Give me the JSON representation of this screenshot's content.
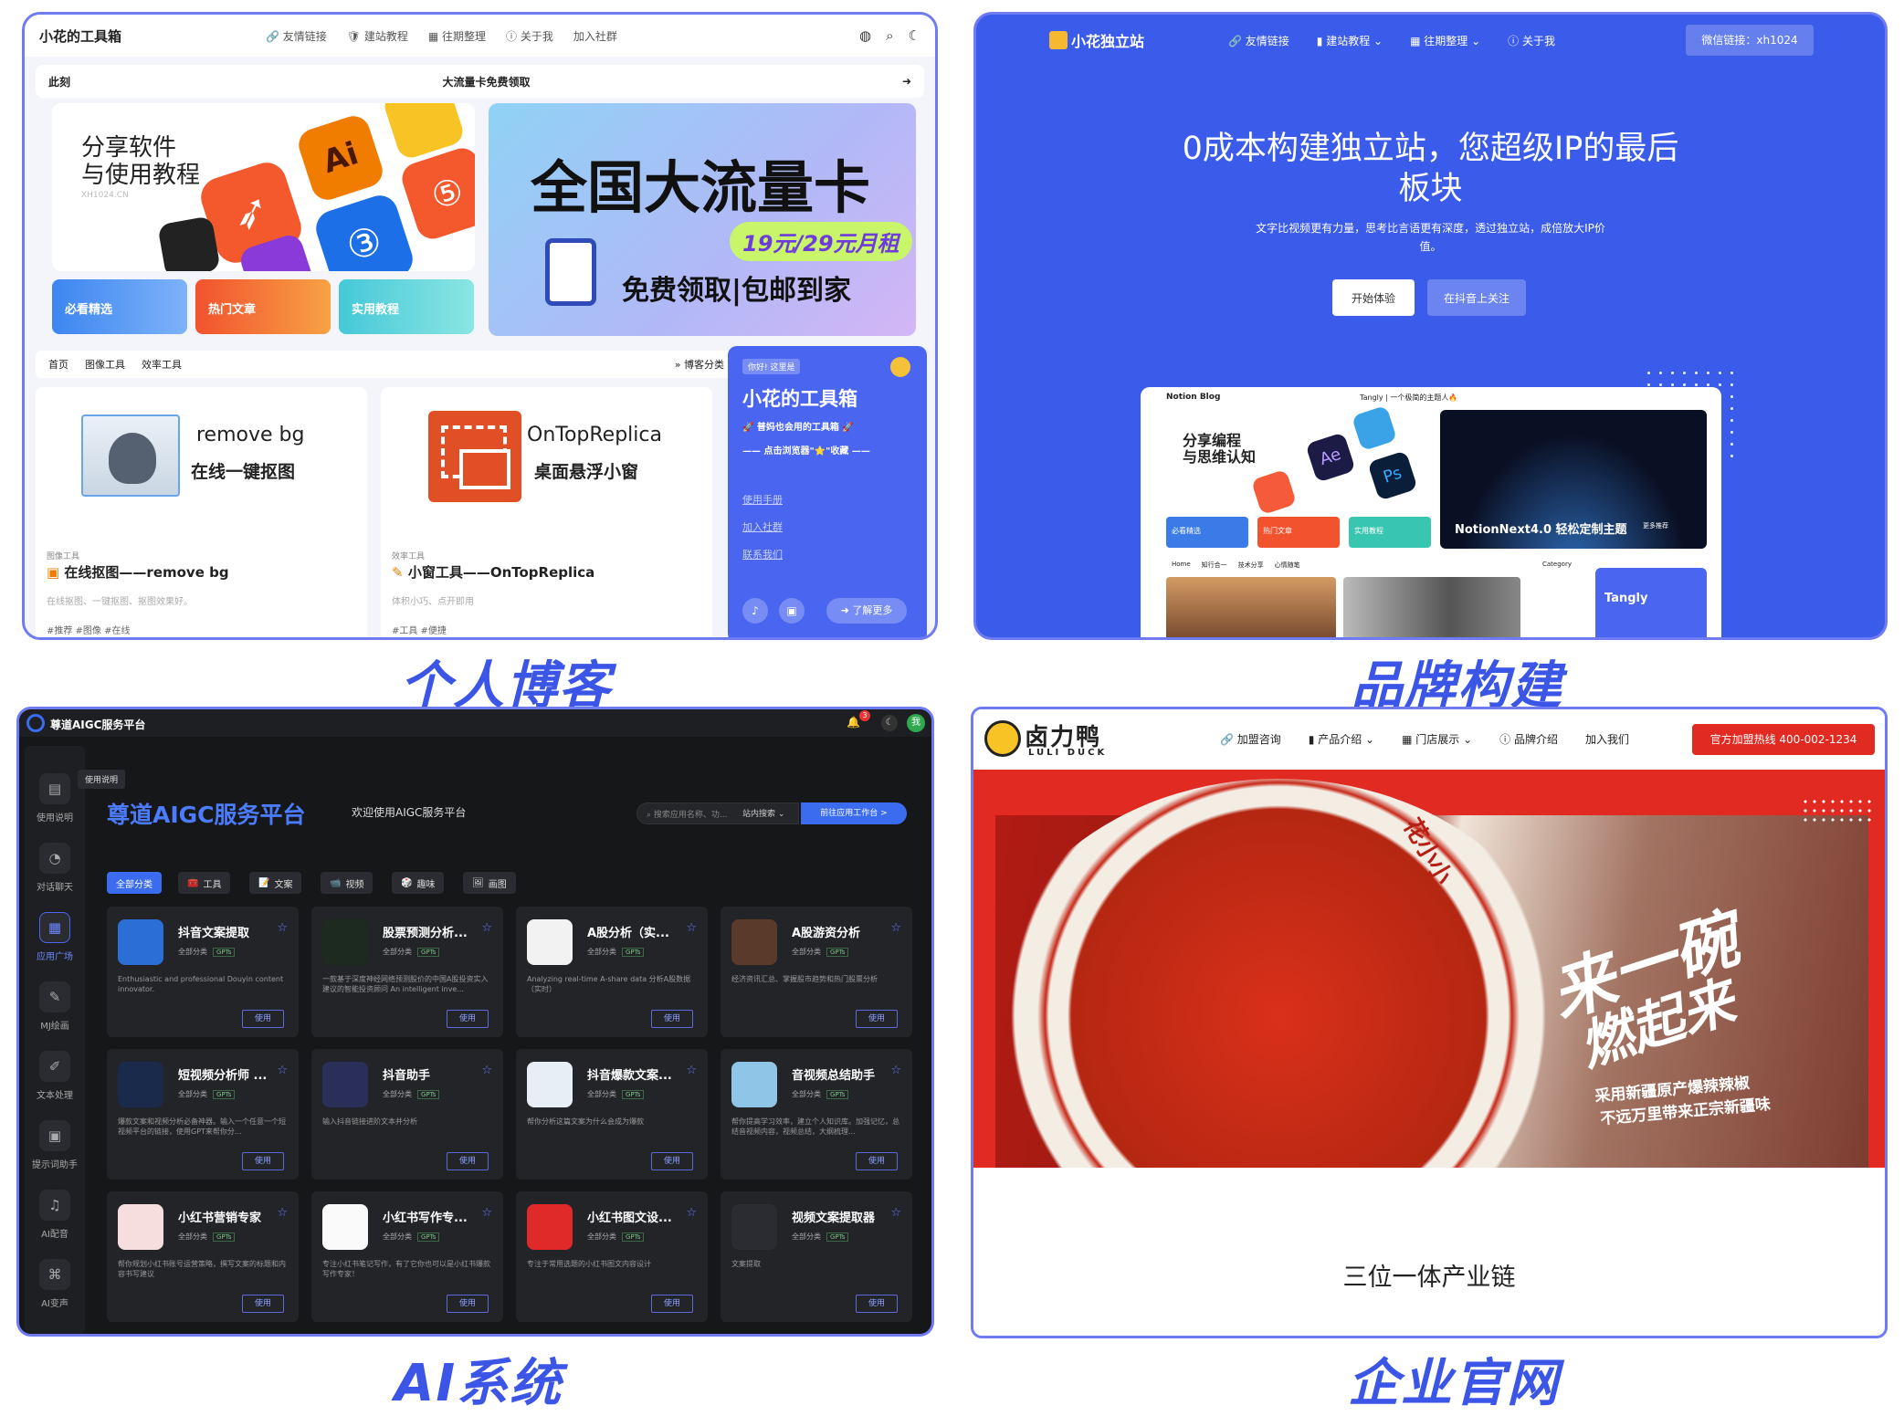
{
  "captions": {
    "blog": "个人博客",
    "brand": "品牌构建",
    "ai": "AI系统",
    "corp": "企业官网"
  },
  "blog": {
    "brand": "小花的工具箱",
    "nav": [
      "友情链接",
      "建站教程",
      "往期整理",
      "关于我",
      "加入社群"
    ],
    "notice_left": "此刻",
    "notice_center": "大流量卡免费领取",
    "banner_share_line1": "分享软件",
    "banner_share_line2": "与使用教程",
    "banner_share_sub": "XH1024.CN",
    "banner_card_title": "全国大流量卡",
    "banner_card_price": "19元/29元月租",
    "banner_card_sub": "免费领取|包邮到家",
    "quick": [
      "必看精选",
      "热门文章",
      "实用教程"
    ],
    "tabs": [
      "首页",
      "图像工具",
      "效率工具"
    ],
    "category_link": "博客分类",
    "cards": [
      {
        "img_title": "remove bg",
        "img_sub": "在线一键抠图",
        "tag": "图像工具",
        "title": "在线抠图——remove bg",
        "desc": "在线抠图、一键抠图、抠图效果好。",
        "tags": "#推荐   #图像   #在线"
      },
      {
        "img_title": "OnTopReplica",
        "img_sub": "桌面悬浮小窗",
        "tag": "效率工具",
        "title": "小窗工具——OnTopReplica",
        "desc": "体积小巧、点开即用",
        "tags": "#工具   #便捷"
      }
    ],
    "side": {
      "badge": "你好! 这里是",
      "title": "小花的工具箱",
      "sub1": "🚀 普妈也会用的工具箱 🚀",
      "sub2": "—— 点击浏览器\"⭐\"收藏 ——",
      "links": [
        "使用手册",
        "加入社群",
        "联系我们"
      ],
      "more": "了解更多"
    }
  },
  "brand": {
    "logo": "小花独立站",
    "nav": [
      "友情链接",
      "建站教程",
      "往期整理",
      "关于我"
    ],
    "wechat": "微信链接：xh1024",
    "headline1": "0成本构建独立站，您超级IP的最后",
    "headline2": "板块",
    "desc1": "文字比视频更有力量，思考比言语更有深度，透过独立站，成倍放大IP价",
    "desc2": "值。",
    "btn_primary": "开始体验",
    "btn_secondary": "在抖音上关注",
    "preview": {
      "title": "Notion Blog",
      "center": "Tangly | 一个极简的主题人🔥",
      "share1": "分享编程",
      "share2": "与思维认知",
      "quick": [
        "必看精选",
        "热门文章",
        "实用教程"
      ],
      "hero_text": "NotionNext4.0 轻松定制主题",
      "hero_btn": "更多推荐",
      "tabs": [
        "Home",
        "知行合一",
        "技术分享",
        "心情随笔"
      ],
      "category": "Category",
      "side_name": "Tangly"
    }
  },
  "ai": {
    "title": "尊道AIGC服务平台",
    "big_title": "尊道AIGC服务平台",
    "welcome": "欢迎使用AIGC服务平台",
    "notif_count": "3",
    "avatar": "我",
    "search_placeholder": "搜索应用名称、功...",
    "search_scope": "站内搜索",
    "go_btn": "前往应用工作台 >",
    "tooltip": "使用说明",
    "side": [
      "使用说明",
      "对话聊天",
      "应用广场",
      "MJ绘画",
      "文本处理",
      "提示词助手",
      "AI配音",
      "AI变声"
    ],
    "chips": [
      "全部分类",
      "工具",
      "文案",
      "视频",
      "趣味",
      "画图"
    ],
    "card_meta": "全部分类",
    "card_badge": "GPTs",
    "use": "使用",
    "cards": [
      {
        "t": "抖音文案提取",
        "d": "Enthusiastic and professional Douyin content innovator.",
        "c": "#2b6fd6"
      },
      {
        "t": "股票预测分析...",
        "d": "一款基于深度神经网络预测股价的中国A股投资实入建议的智能投资顾问 An intelligent inve...",
        "c": "#1d2a1f"
      },
      {
        "t": "A股分析（实...",
        "d": "Analyzing real-time A-share data 分析A股数据（实时）",
        "c": "#f2f2f2"
      },
      {
        "t": "A股游资分析",
        "d": "经济资讯汇总、掌握股市趋势和热门股票分析",
        "c": "#5a3a2a"
      },
      {
        "t": "短视频分析师 ...",
        "d": "爆款文案和视频分析必备神器。输入一个任意一个短视频平台的链接，使用GPT来帮你分...",
        "c": "#1a2a4a"
      },
      {
        "t": "抖音助手",
        "d": "输入抖音链接进阶文本并分析",
        "c": "#2a2f5a"
      },
      {
        "t": "抖音爆款文案...",
        "d": "帮你分析这篇文案为什么会成为爆款",
        "c": "#e8eef5"
      },
      {
        "t": "音视频总结助手",
        "d": "帮你提高学习效率，建立个人知识库。加强记忆，总结音视频内容，视频总结，大纲梳理...",
        "c": "#8fc6e8"
      },
      {
        "t": "小红书营销专家",
        "d": "帮你规划小红书账号运营策略，撰写文案的标题和内容书写建议",
        "c": "#f6dede"
      },
      {
        "t": "小红书写作专...",
        "d": "专注小红书笔记写作，有了它你也可以是小红书爆款写作专家！",
        "c": "#fafafa"
      },
      {
        "t": "小红书图文设...",
        "d": "专注于常用选题的小红书图文内容设计",
        "c": "#e02a2a"
      },
      {
        "t": "视频文案提取器",
        "d": "文案提取",
        "c": "#2a2c31"
      }
    ]
  },
  "corp": {
    "logo": "卤力鸭",
    "logo_en": "LULI DUCK",
    "nav": [
      "加盟咨询",
      "产品介绍",
      "门店展示",
      "品牌介绍",
      "加入我们"
    ],
    "hotline": "官方加盟热线 400-002-1234",
    "hero_big1": "来一碗",
    "hero_big2": "燃起来",
    "hero_line1": "采用新疆原产爆辣辣椒",
    "hero_line2": "不远万里带来正宗新疆味",
    "bowl_text": "花小小",
    "footer_text": "三位一体产业链"
  },
  "colors": {
    "accent": "#3b5bea",
    "red": "#e12a22",
    "dark": "#161719"
  }
}
